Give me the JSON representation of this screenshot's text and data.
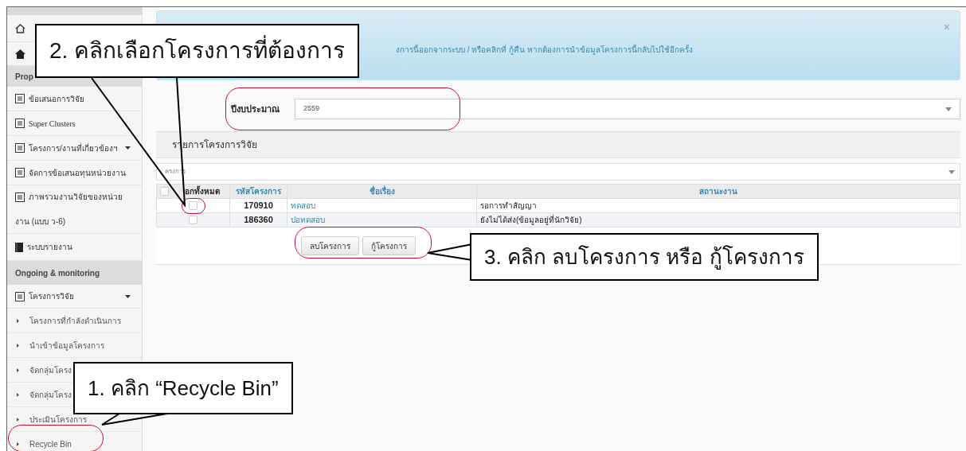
{
  "sidebar": {
    "rows": [
      {
        "kind": "home"
      },
      {
        "kind": "house"
      },
      {
        "kind": "header",
        "label": "Prop"
      },
      {
        "kind": "item",
        "label": "ข้อเสนอการวิจัย",
        "submenu": false
      },
      {
        "kind": "item",
        "label": "Super Clusters",
        "submenu": false
      },
      {
        "kind": "item",
        "label": "โครงการ/งานที่เกี่ยวข้องฯ",
        "submenu": true
      },
      {
        "kind": "item",
        "label": "จัดการข้อเสนอทุนหน่วยงาน",
        "submenu": false
      },
      {
        "kind": "wrap",
        "label": "ภาพรวมงานวิจัยของหน่วย",
        "label_2": "งาน (แบบ ว-6)"
      },
      {
        "kind": "report",
        "label": "ระบบรายงาน"
      },
      {
        "kind": "header",
        "label": "Ongoing & monitoring"
      },
      {
        "kind": "item",
        "label": "โครงการวิจัย",
        "submenu": true
      },
      {
        "kind": "subitem",
        "label": "โครงการที่กำลังดำเนินการ"
      },
      {
        "kind": "subitem",
        "label": "นำเข้าข้อมูลโครงการ"
      },
      {
        "kind": "subitem",
        "label": "จัดกลุ่มโครง"
      },
      {
        "kind": "subitem",
        "label": "จัดกลุ่มโครง"
      },
      {
        "kind": "subitem",
        "label": "ประเมินโครงการ"
      },
      {
        "kind": "subitem",
        "label": "Recycle Bin",
        "highlighted": true
      }
    ]
  },
  "alert": {
    "message": "งการนี้ออกจากระบบ / หรือคลิกที่ กู้คืน หากต้องการนำข้อมูลโครงการนี้กลับไปใช้อีกครั้ง",
    "close": "×"
  },
  "budget": {
    "label": "ปีงบประมาณ",
    "value": "2559",
    "highlighted": true
  },
  "panel": {
    "title": "รายการโครงการวิจัย",
    "filter_placeholder": "ครงการ",
    "table": {
      "columns": [
        "อกทั้งหมด",
        "รหัสโครงการ",
        "ชื่อเรื่อง",
        "สถานะงาน"
      ],
      "select_all_checked": false,
      "rows": [
        {
          "checked": false,
          "highlighted": true,
          "code": "170910",
          "title": "ทดสอบ",
          "status": "รอการทำสัญญา"
        },
        {
          "checked": false,
          "code": "186360",
          "title": "ปอทดสอบ",
          "status": "ยังไม่ได้ส่ง(ข้อมูลอยู่ที่นักวิจัย)"
        }
      ]
    },
    "buttons": [
      "ลบโครงการ",
      "กู้โครงการ"
    ],
    "buttons_highlighted": true
  },
  "callouts": [
    {
      "text": "2. คลิกเลือกโครงการที่ต้องการ"
    },
    {
      "text": "3. คลิก ลบโครงการ หรือ กู้โครงการ"
    },
    {
      "text": "1. คลิก “Recycle Bin”"
    }
  ]
}
